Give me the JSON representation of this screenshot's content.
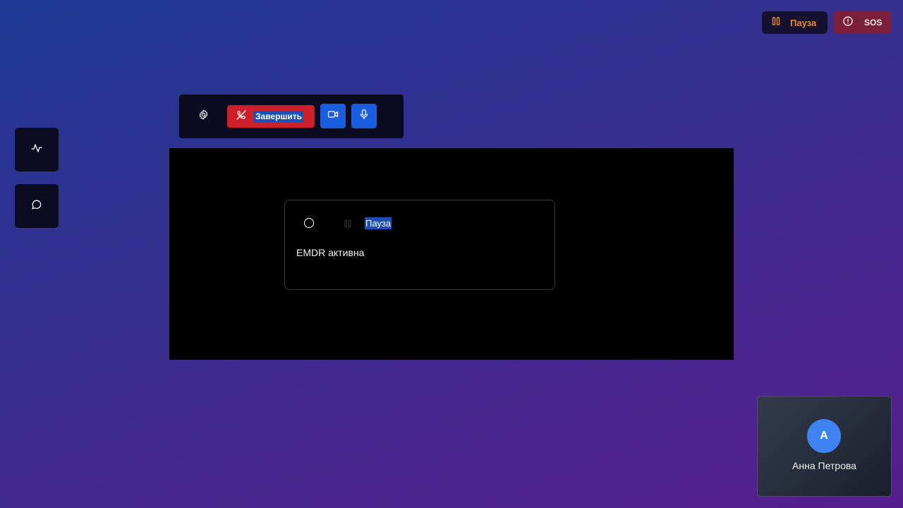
{
  "top_controls": {
    "pause_label": "Пауза",
    "sos_label": "SOS"
  },
  "sidebar": {
    "items": [
      {
        "icon": "activity-icon"
      },
      {
        "icon": "chat-icon"
      }
    ]
  },
  "toolbar": {
    "end_call_label": "Завершить",
    "icons": [
      "gear-icon",
      "phone-off-icon",
      "video-icon",
      "mic-icon"
    ]
  },
  "emdr_panel": {
    "pause_label": "Пауза",
    "status": "EMDR активна"
  },
  "participant": {
    "initial": "А",
    "name": "Анна Петрова"
  },
  "colors": {
    "end_call": "#cc1f29",
    "media_button": "#1b5de0",
    "sos": "#7a1e3a",
    "pause_accent": "#f08a2a",
    "avatar": "#3f83f2"
  }
}
